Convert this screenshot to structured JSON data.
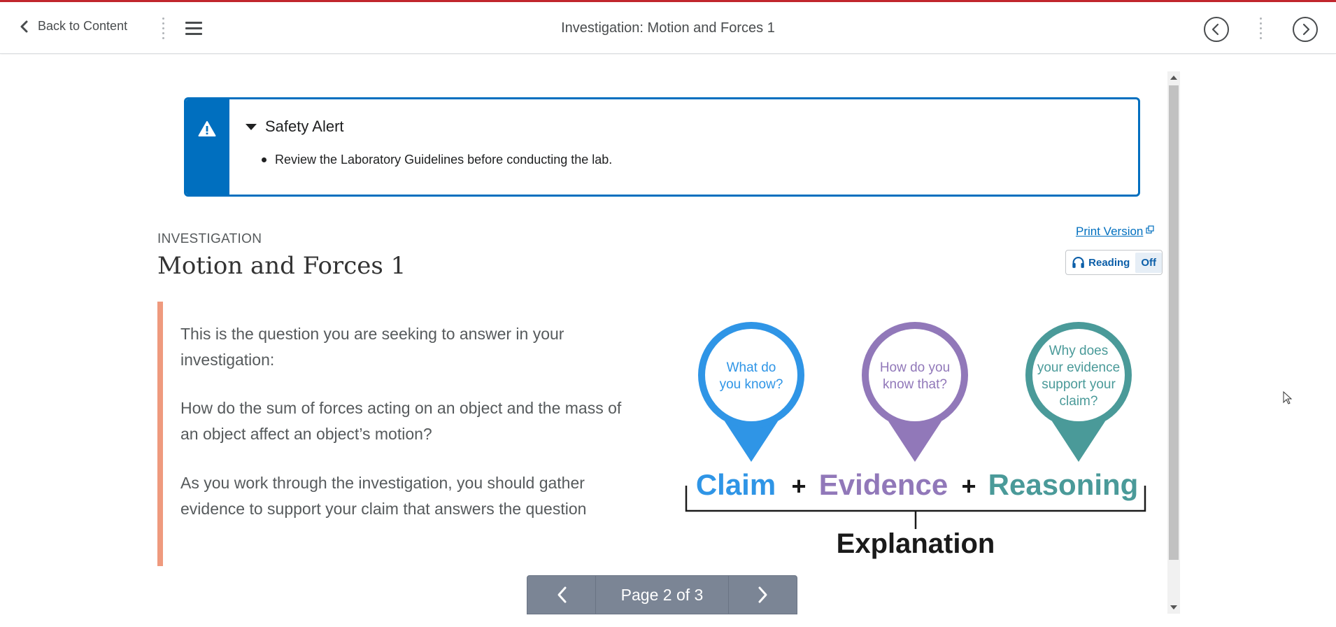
{
  "navbar": {
    "back_label": "Back to Content",
    "title": "Investigation: Motion and Forces 1"
  },
  "alert": {
    "title": "Safety Alert",
    "items": [
      "Review the Laboratory Guidelines before conducting the lab."
    ]
  },
  "content": {
    "kicker": "INVESTIGATION",
    "heading": "Motion and Forces 1",
    "print_label": "Print Version",
    "reading_label": "Reading",
    "reading_state": "Off",
    "paragraphs": [
      "This is the question you are seeking to answer in your investigation:",
      "How do the sum of forces acting on an object and the mass of an object affect an object’s motion?",
      "As you work through the investigation, you should gather evidence to support your claim that answers the question"
    ]
  },
  "cer_graphic": {
    "pins": [
      {
        "text_lines": [
          "What do",
          "you know?"
        ],
        "color": "#2f95e6"
      },
      {
        "text_lines": [
          "How do you",
          "know that?"
        ],
        "color": "#9178b9"
      },
      {
        "text_lines": [
          "Why does",
          "your evidence",
          "support your",
          "claim?"
        ],
        "color": "#4a9a99"
      }
    ],
    "words": [
      {
        "text": "Claim",
        "color": "#2f95e6"
      },
      {
        "text": "+",
        "color": "#1a1a1a"
      },
      {
        "text": "Evidence",
        "color": "#9178b9"
      },
      {
        "text": "+",
        "color": "#1a1a1a"
      },
      {
        "text": "Reasoning",
        "color": "#4a9a99"
      }
    ],
    "result": "Explanation"
  },
  "pager": {
    "label": "Page 2 of 3"
  },
  "colors": {
    "brand_top": "#c1272d",
    "alert_blue": "#006fbf",
    "quote_bar": "#ef9a7e",
    "pager_bg": "#7b8595"
  }
}
